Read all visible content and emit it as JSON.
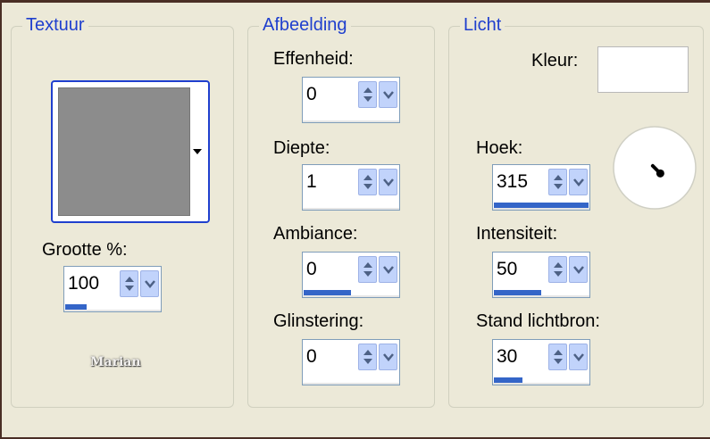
{
  "textuur": {
    "legend": "Textuur",
    "size_label": "Grootte %:",
    "size_value": "100",
    "size_level": 0.23,
    "watermark": "Marian"
  },
  "afbeelding": {
    "legend": "Afbeelding",
    "fields": [
      {
        "label": "Effenheid:",
        "value": "0",
        "level": 0
      },
      {
        "label": "Diepte:",
        "value": "1",
        "level": 0
      },
      {
        "label": "Ambiance:",
        "value": "0",
        "level": 0.5
      },
      {
        "label": "Glinstering:",
        "value": "0",
        "level": 0
      }
    ]
  },
  "licht": {
    "legend": "Licht",
    "color_label": "Kleur:",
    "color_value": "#ffffff",
    "fields": [
      {
        "label": "Hoek:",
        "value": "315",
        "level": 1
      },
      {
        "label": "Intensiteit:",
        "value": "50",
        "level": 0.5
      },
      {
        "label": "Stand lichtbron:",
        "value": "30",
        "level": 0.3
      }
    ],
    "dial_angle": 315
  },
  "colors": {
    "legend": "#1f3fce",
    "border": "#4a2e25",
    "spin_button": "#c1d3fb",
    "progress": "#3465c8"
  },
  "icons": [
    "chevron-down-icon",
    "spin-up-icon",
    "spin-down-icon"
  ]
}
